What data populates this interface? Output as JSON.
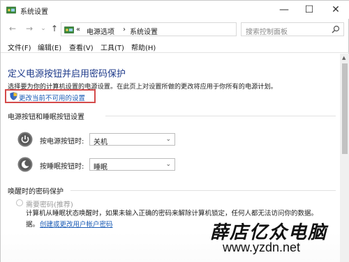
{
  "window": {
    "title": "系统设置",
    "controls": {
      "minimize": "—",
      "maximize": "☐",
      "close": "✕"
    }
  },
  "navigation": {
    "back": "←",
    "forward": "→",
    "recent": "⌄",
    "up": "↑",
    "breadcrumb_sep": "«",
    "breadcrumb": [
      "电源选项",
      "系统设置"
    ],
    "breadcrumb_arrow": "›",
    "dropdown_glyph": "⌄",
    "refresh_glyph": "↻",
    "search_placeholder": "搜索控制面板"
  },
  "menu": [
    "文件(F)",
    "编辑(E)",
    "查看(V)",
    "工具(T)",
    "帮助(H)"
  ],
  "content": {
    "heading": "定义电源按钮并启用密码保护",
    "description": "选择要为你的计算机设置的电源设置。在此页上对设置所做的更改将应用于你所有的电源计划。",
    "change_link": "更改当前不可用的设置",
    "power_section": {
      "title": "电源按钮和睡眠按钮设置",
      "rows": [
        {
          "label": "按电源按钮时:",
          "value": "关机"
        },
        {
          "label": "按睡眠按钮时:",
          "value": "睡眠"
        }
      ],
      "dropdown_glyph": "⌄"
    },
    "wake_section": {
      "title": "唤醒时的密码保护",
      "radio_label": "需要密码(推荐)",
      "desc_line1": "计算机从睡眠状态唤醒时，如果未输入正确的密码来解除计算机锁定，任何人都无法访问你的数据。",
      "desc_prefix": "据。",
      "account_link": "创建或更改用户帐户密码"
    }
  },
  "watermark": {
    "chinese": "薛店亿众电脑",
    "url": "www.yzdn.net"
  },
  "colors": {
    "heading": "#1e3a8a",
    "link": "#1a5bb5",
    "highlight_box": "#d44a4a",
    "power_icon": "#6b6b6b"
  }
}
